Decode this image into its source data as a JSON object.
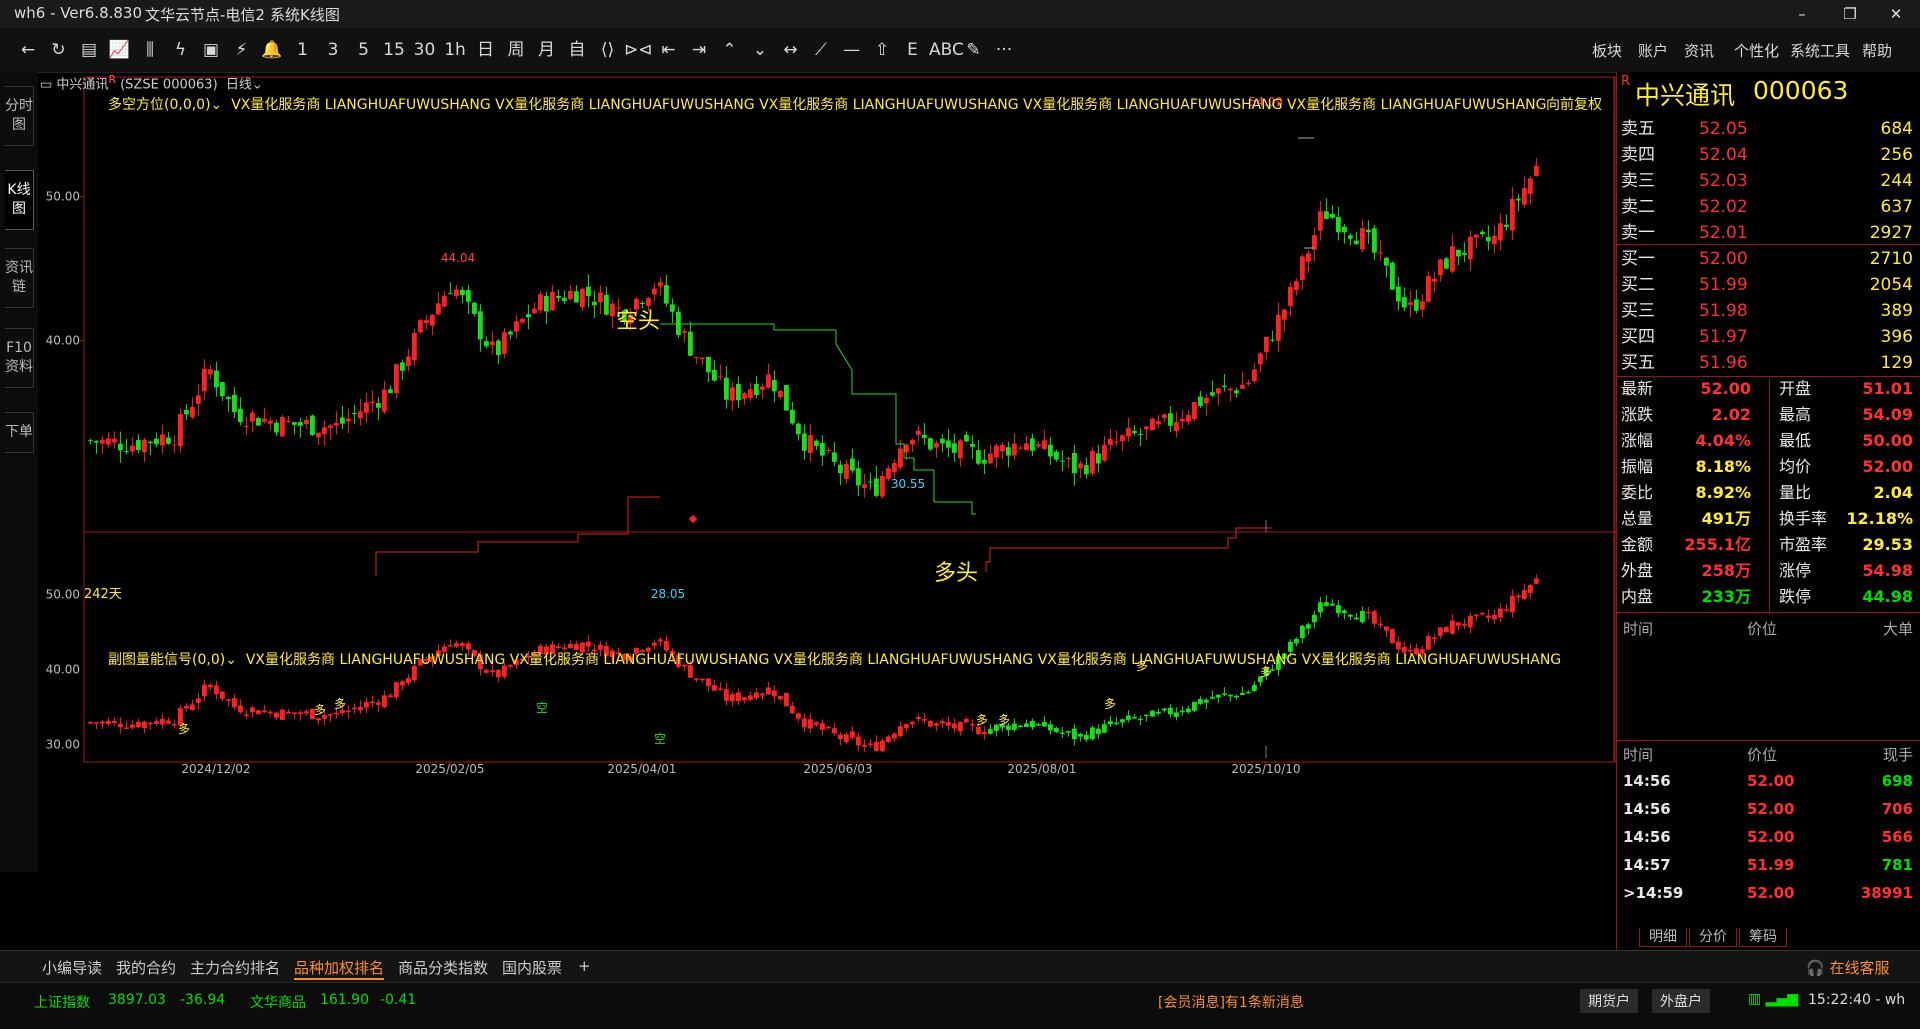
{
  "title": {
    "app": "wh6 - Ver6.8.830",
    "node": "文华云节点-电信2",
    "view": "系统K线图"
  },
  "window_controls": {
    "min": "–",
    "max": "❐",
    "close": "✕"
  },
  "toolbar": {
    "buttons": [
      "←",
      "↻",
      "▤",
      "📈",
      "⫼",
      "ϟ",
      "▣",
      "⚡",
      "🔔",
      "1",
      "3",
      "5",
      "15",
      "30",
      "1h",
      "日",
      "周",
      "月",
      "自",
      "⟨⟩",
      "⊳⊲",
      "⇤",
      "⇥",
      "⌃",
      "⌄",
      "↔",
      "⟋",
      "—",
      "⇧",
      "E",
      "ABC",
      "✎",
      "···"
    ],
    "menu": [
      "板块",
      "账户",
      "资讯",
      "个性化",
      "系统工具",
      "帮助"
    ]
  },
  "side_tabs": [
    "分时图",
    "K线图",
    "资讯链",
    "F10资料",
    "下单"
  ],
  "chart": {
    "symbol_header": "中兴通讯",
    "symbol_code": "(SZSE 000063)",
    "period": "日线",
    "adjust": "向前复权",
    "main_indicator": "多空方位(0,0,0)",
    "main_banner": "VX量化服务商  LIANGHUAFUWUSHANG  VX量化服务商  LIANGHUAFUWUSHANG  VX量化服务商  LIANGHUAFUWUSHANG  VX量化服务商  LIANGHUAFUWUSHANG  VX量化服务商  LIANGHUAFUWUSHANG",
    "sub_indicator": "副图量能信号(0,0)",
    "sub_banner": "VX量化服务商  LIANGHUAFUWUSHANG  VX量化服务商  LIANGHUAFUWUSHANG  VX量化服务商  LIANGHUAFUWUSHANG  VX量化服务商  LIANGHUAFUWUSHANG  VX量化服务商  LIANGHUAFUWUSHANG",
    "days": "242天",
    "label_short": "空头",
    "label_long": "多头",
    "high_label": "44.04",
    "max_label": "54.09",
    "low_label": "28.05",
    "low2_label": "30.55",
    "main_y_ticks": [
      "50.00",
      "40.00"
    ],
    "sub_y_ticks": [
      "50.00",
      "40.00",
      "30.00"
    ],
    "x_ticks": [
      "2024/12/02",
      "2025/02/05",
      "2025/04/01",
      "2025/06/03",
      "2025/08/01",
      "2025/10/10"
    ],
    "duo": "多",
    "kong": "空"
  },
  "chart_data": {
    "type": "candlestick",
    "ylim": [
      24,
      57
    ],
    "ref_points": [
      {
        "label": "start",
        "x": "2024-10",
        "close": 33
      },
      {
        "label": "high",
        "x": "2025-02",
        "value": 44.04
      },
      {
        "label": "low",
        "x": "2025-04",
        "value": 28.05
      },
      {
        "label": "low2",
        "x": "2025-07",
        "value": 30.55
      },
      {
        "label": "max",
        "x": "2025-10",
        "value": 54.09
      }
    ]
  },
  "quote": {
    "name": "中兴通讯",
    "code": "000063",
    "r_mark": "R",
    "asks": [
      {
        "label": "卖五",
        "price": "52.05",
        "vol": "684"
      },
      {
        "label": "卖四",
        "price": "52.04",
        "vol": "256"
      },
      {
        "label": "卖三",
        "price": "52.03",
        "vol": "244"
      },
      {
        "label": "卖二",
        "price": "52.02",
        "vol": "637"
      },
      {
        "label": "卖一",
        "price": "52.01",
        "vol": "2927"
      }
    ],
    "bids": [
      {
        "label": "买一",
        "price": "52.00",
        "vol": "2710"
      },
      {
        "label": "买二",
        "price": "51.99",
        "vol": "2054"
      },
      {
        "label": "买三",
        "price": "51.98",
        "vol": "389"
      },
      {
        "label": "买四",
        "price": "51.97",
        "vol": "396"
      },
      {
        "label": "买五",
        "price": "51.96",
        "vol": "129"
      }
    ],
    "stats": [
      {
        "l1": "最新",
        "v1": "52.00",
        "c1": "red",
        "l2": "开盘",
        "v2": "51.01",
        "c2": "red"
      },
      {
        "l1": "涨跌",
        "v1": "2.02",
        "c1": "red",
        "l2": "最高",
        "v2": "54.09",
        "c2": "red"
      },
      {
        "l1": "涨幅",
        "v1": "4.04%",
        "c1": "red",
        "l2": "最低",
        "v2": "50.00",
        "c2": "red"
      },
      {
        "l1": "振幅",
        "v1": "8.18%",
        "c1": "yellow",
        "l2": "均价",
        "v2": "52.00",
        "c2": "red"
      },
      {
        "l1": "委比",
        "v1": "8.92%",
        "c1": "yellow",
        "l2": "量比",
        "v2": "2.04",
        "c2": "yellow"
      },
      {
        "l1": "总量",
        "v1": "491万",
        "c1": "yellow",
        "l2": "换手率",
        "v2": "12.18%",
        "c2": "yellow"
      },
      {
        "l1": "金额",
        "v1": "255.1亿",
        "c1": "red",
        "l2": "市盈率",
        "v2": "29.53",
        "c2": "yellow"
      },
      {
        "l1": "外盘",
        "v1": "258万",
        "c1": "red",
        "l2": "涨停",
        "v2": "54.98",
        "c2": "red"
      },
      {
        "l1": "内盘",
        "v1": "233万",
        "c1": "green",
        "l2": "跌停",
        "v2": "44.98",
        "c2": "green"
      }
    ],
    "big_header": {
      "time": "时间",
      "price": "价位",
      "vol": "大单"
    },
    "tick_header": {
      "time": "时间",
      "price": "价位",
      "vol": "现手"
    },
    "ticks": [
      {
        "time": "14:56",
        "price": "52.00",
        "vol": "698",
        "vc": "green"
      },
      {
        "time": "14:56",
        "price": "52.00",
        "vol": "706",
        "vc": "red"
      },
      {
        "time": "14:56",
        "price": "52.00",
        "vol": "566",
        "vc": "red"
      },
      {
        "time": "14:57",
        "price": "51.99",
        "vol": "781",
        "vc": "green"
      },
      {
        "time": ">14:59",
        "price": "52.00",
        "vol": "38991",
        "vc": "red"
      }
    ],
    "detail_tabs": [
      "明细",
      "分价",
      "筹码"
    ]
  },
  "bottom_tabs": [
    "小编导读",
    "我的合约",
    "主力合约排名",
    "品种加权排名",
    "商品分类指数",
    "国内股票",
    "+"
  ],
  "service": "在线客服",
  "status": {
    "idx1_name": "上证指数",
    "idx1_val": "3897.03",
    "idx1_chg": "-36.94",
    "idx2_name": "文华商品",
    "idx2_val": "161.90",
    "idx2_chg": "-0.41",
    "message": "[会员消息]有1条新消息",
    "btn_futures": "期货户",
    "btn_outer": "外盘户",
    "time": "15:22:40 - wh"
  }
}
